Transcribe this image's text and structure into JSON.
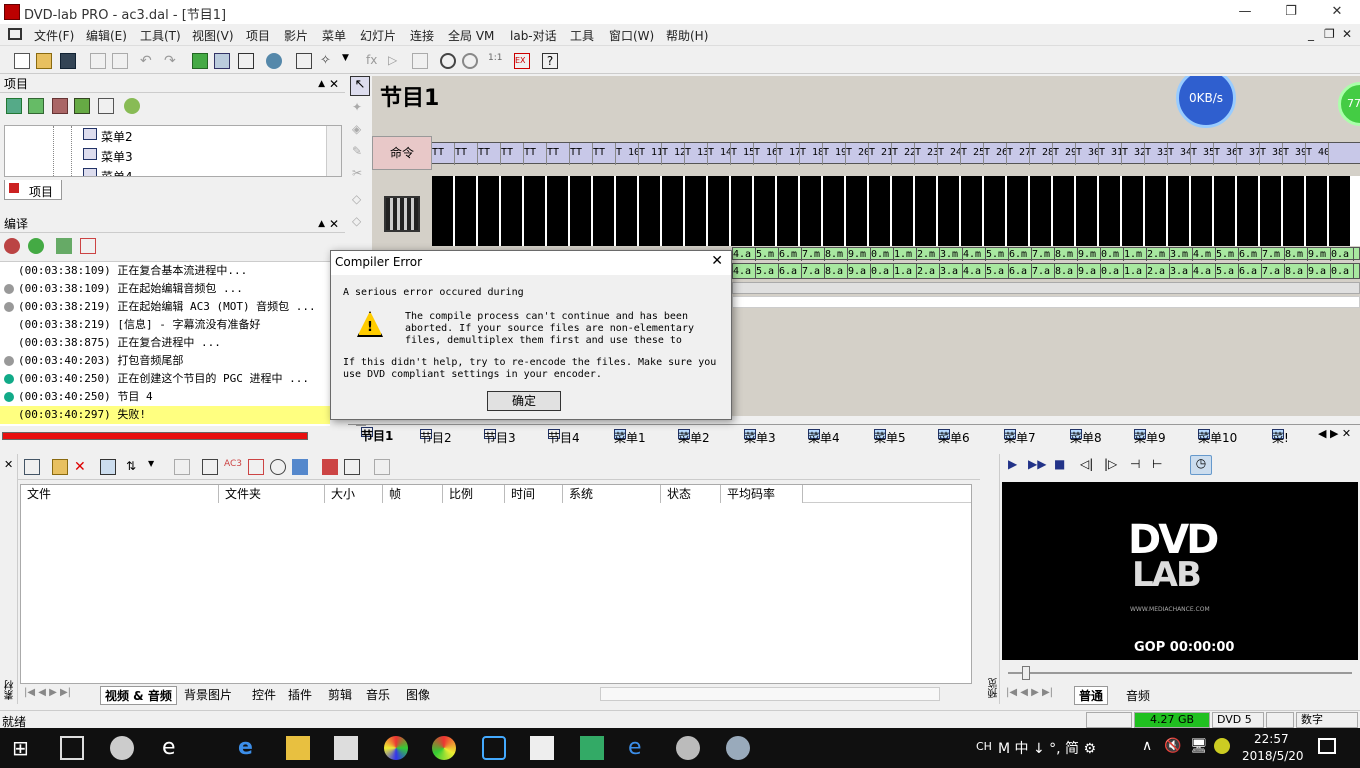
{
  "window": {
    "title": "DVD-lab PRO - ac3.dal - [节目1]",
    "minimize": "—",
    "maximize": "❐",
    "close": "✕"
  },
  "menu": [
    "文件(F)",
    "编辑(E)",
    "工具(T)",
    "视图(V)",
    "项目",
    "影片",
    "菜单",
    "幻灯片",
    "连接",
    "全局 VM",
    "lab-对话",
    "工具",
    "窗口(W)",
    "帮助(H)"
  ],
  "mdi_controls": [
    "_",
    "❐",
    "✕"
  ],
  "project_panel": {
    "title": "项目",
    "tree": [
      "菜单2",
      "菜单3",
      "菜单4"
    ],
    "tab": "项目"
  },
  "compile_panel": {
    "title": "编译",
    "log": [
      {
        "text": "(00:03:38:109) 正在复合基本流进程中...",
        "icon": "none"
      },
      {
        "text": "(00:03:38:109) 正在起始编辑音频包 ...",
        "icon": "audio-icon"
      },
      {
        "text": "(00:03:38:219) 正在起始编辑 AC3 (MOT) 音频包 ...",
        "icon": "audio-icon"
      },
      {
        "text": "(00:03:38:219) [信息] - 字幕流没有准备好",
        "icon": "none"
      },
      {
        "text": "(00:03:38:875) 正在复合进程中 ...",
        "icon": "none"
      },
      {
        "text": "(00:03:40:203) 打包音频尾部",
        "icon": "audio-icon"
      },
      {
        "text": "(00:03:40:250) 正在创建这个节目的 PGC 进程中 ...",
        "icon": "diamond-icon"
      },
      {
        "text": "(00:03:40:250) 节目 4",
        "icon": "diamond-icon"
      },
      {
        "text": "(00:03:40:297) 失败!",
        "icon": "hand-icon",
        "highlight": true
      }
    ]
  },
  "timeline": {
    "title": "节目1",
    "speed": "0KB/s",
    "speed_extra": "77",
    "command_label": "命令",
    "cmd_cells": [
      "TT",
      "TT",
      "TT",
      "TT",
      "TT",
      "TT",
      "TT",
      "TT",
      "T 10",
      "T 11",
      "T 12",
      "T 13",
      "T 14",
      "T 15",
      "T 16",
      "T 17",
      "T 18",
      "T 19",
      "T 20",
      "T 21",
      "T 22",
      "T 23",
      "T 24",
      "T 25",
      "T 26",
      "T 27",
      "T 28",
      "T 29",
      "T 30",
      "T 31",
      "T 32",
      "T 33",
      "T 34",
      "T 35",
      "T 36",
      "T 37",
      "T 38",
      "T 39",
      "T 40"
    ],
    "audio_top": [
      "4.a",
      "5.m",
      "6.m",
      "7.m",
      "8.m",
      "9.m",
      "0.m",
      "1.m",
      "2.m",
      "3.m",
      "4.m",
      "5.m",
      "6.m",
      "7.m",
      "8.m",
      "9.m",
      "0.m",
      "1.m",
      "2.m",
      "3.m",
      "4.m",
      "5.m",
      "6.m",
      "7.m",
      "8.m",
      "9.m",
      "0.a"
    ],
    "audio_bottom": [
      "4.a",
      "5.a",
      "6.a",
      "7.a",
      "8.a",
      "9.a",
      "0.a",
      "1.a",
      "2.a",
      "3.a",
      "4.a",
      "5.a",
      "6.a",
      "7.a",
      "8.a",
      "9.a",
      "0.a",
      "1.a",
      "2.a",
      "3.a",
      "4.a",
      "5.a",
      "6.a",
      "7.a",
      "8.a",
      "9.a",
      "0.a"
    ]
  },
  "tabs": [
    "节目1",
    "节目2",
    "节目3",
    "节目4",
    "菜单1",
    "菜单2",
    "菜单3",
    "菜单4",
    "菜单5",
    "菜单6",
    "菜单7",
    "菜单8",
    "菜单9",
    "菜单10",
    "菜!"
  ],
  "assets": {
    "columns": [
      "文件",
      "文件夹",
      "大小",
      "帧",
      "比例",
      "时间",
      "系统",
      "状态",
      "平均码率"
    ],
    "side_label": "素材",
    "bottom_tabs": [
      "视频 & 音频",
      "背景图片",
      "控件",
      "插件",
      "剪辑",
      "音乐",
      "图像"
    ]
  },
  "preview": {
    "logo_line1": "DVD",
    "logo_line2": "LAB",
    "logo_url": "WWW.MEDIACHANCE.COM",
    "gop": "GOP 00:00:00",
    "side_label": "预览",
    "tabs": [
      "普通",
      "音频"
    ]
  },
  "dialog": {
    "title": "Compiler Error",
    "line1": "A serious error occured during",
    "body": "The compile process can't continue and has been aborted. If your source files are non-elementary files, demultiplex them first and use these to",
    "body2": "If this didn't help, try to re-encode the files. Make sure you use DVD compliant settings in your encoder.",
    "ok": "确定"
  },
  "status": {
    "ready": "就绪",
    "disk": "4.27 GB",
    "dvd": "DVD 5",
    "num": "数字"
  },
  "taskbar": {
    "time": "22:57",
    "date": "2018/5/20",
    "ime": "CH",
    "tray": "M 中 ↓ °, 简 ⚙"
  },
  "colors": {
    "progress_fail": "#e81010",
    "log_fail_highlight": "#ffff80",
    "cmd_bg": "#c8c8e8",
    "audio_green": "#a8e8a0",
    "disk_green": "#20c020"
  }
}
